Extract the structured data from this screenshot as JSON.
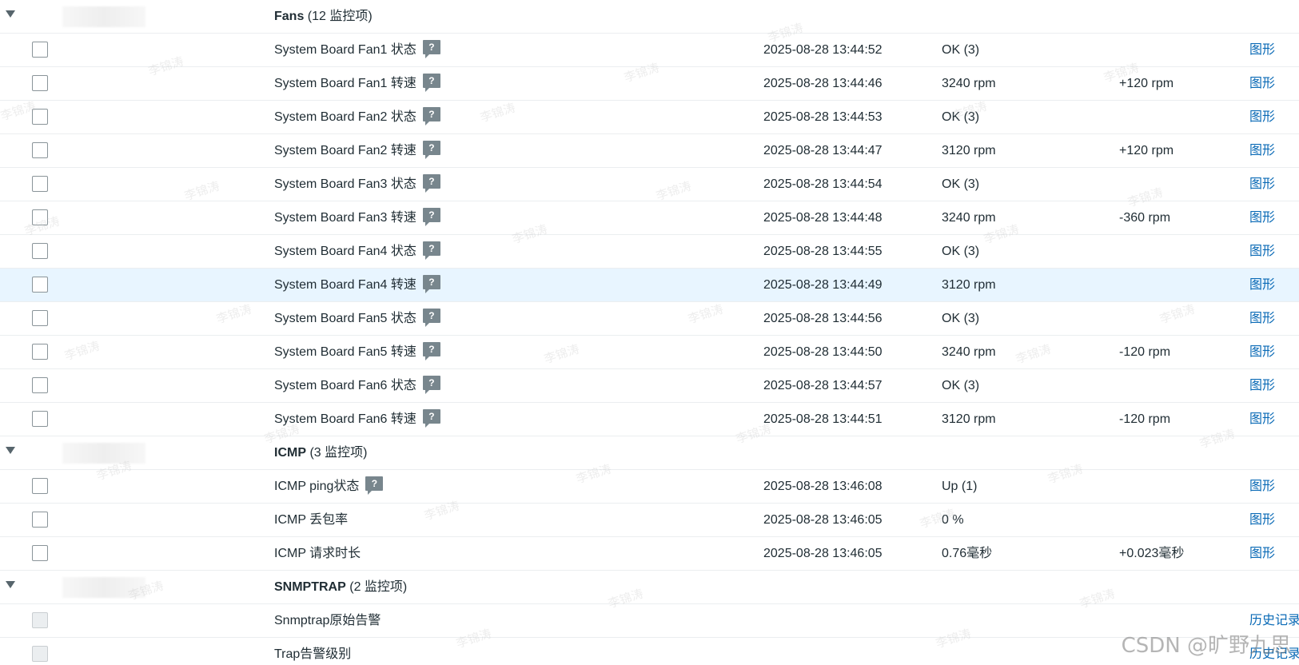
{
  "colors": {
    "link": "#0a6ab6",
    "highlight_row": "#e8f5ff",
    "help_icon_bg": "#78868d",
    "border": "#ebeef0"
  },
  "groups": [
    {
      "name": "Fans",
      "count": "(12 监控项)",
      "items": [
        {
          "name": "System Board Fan1 状态",
          "help": "?",
          "time": "2025-08-28 13:44:52",
          "value": "OK (3)",
          "change": "",
          "link": "图形"
        },
        {
          "name": "System Board Fan1 转速",
          "help": "?",
          "time": "2025-08-28 13:44:46",
          "value": "3240 rpm",
          "change": "+120 rpm",
          "link": "图形"
        },
        {
          "name": "System Board Fan2 状态",
          "help": "?",
          "time": "2025-08-28 13:44:53",
          "value": "OK (3)",
          "change": "",
          "link": "图形"
        },
        {
          "name": "System Board Fan2 转速",
          "help": "?",
          "time": "2025-08-28 13:44:47",
          "value": "3120 rpm",
          "change": "+120 rpm",
          "link": "图形"
        },
        {
          "name": "System Board Fan3 状态",
          "help": "?",
          "time": "2025-08-28 13:44:54",
          "value": "OK (3)",
          "change": "",
          "link": "图形"
        },
        {
          "name": "System Board Fan3 转速",
          "help": "?",
          "time": "2025-08-28 13:44:48",
          "value": "3240 rpm",
          "change": "-360 rpm",
          "link": "图形"
        },
        {
          "name": "System Board Fan4 状态",
          "help": "?",
          "time": "2025-08-28 13:44:55",
          "value": "OK (3)",
          "change": "",
          "link": "图形"
        },
        {
          "name": "System Board Fan4 转速",
          "help": "?",
          "time": "2025-08-28 13:44:49",
          "value": "3120 rpm",
          "change": "",
          "link": "图形"
        },
        {
          "name": "System Board Fan5 状态",
          "help": "?",
          "time": "2025-08-28 13:44:56",
          "value": "OK (3)",
          "change": "",
          "link": "图形"
        },
        {
          "name": "System Board Fan5 转速",
          "help": "?",
          "time": "2025-08-28 13:44:50",
          "value": "3240 rpm",
          "change": "-120 rpm",
          "link": "图形"
        },
        {
          "name": "System Board Fan6 状态",
          "help": "?",
          "time": "2025-08-28 13:44:57",
          "value": "OK (3)",
          "change": "",
          "link": "图形"
        },
        {
          "name": "System Board Fan6 转速",
          "help": "?",
          "time": "2025-08-28 13:44:51",
          "value": "3120 rpm",
          "change": "-120 rpm",
          "link": "图形"
        }
      ]
    },
    {
      "name": "ICMP",
      "count": "(3 监控项)",
      "items": [
        {
          "name": "ICMP ping状态",
          "help": "?",
          "time": "2025-08-28 13:46:08",
          "value": "Up (1)",
          "change": "",
          "link": "图形"
        },
        {
          "name": "ICMP 丢包率",
          "help": "",
          "time": "2025-08-28 13:46:05",
          "value": "0 %",
          "change": "",
          "link": "图形"
        },
        {
          "name": "ICMP 请求时长",
          "help": "",
          "time": "2025-08-28 13:46:05",
          "value": "0.76毫秒",
          "change": "+0.023毫秒",
          "link": "图形"
        }
      ]
    },
    {
      "name": "SNMPTRAP",
      "count": "(2 监控项)",
      "items": [
        {
          "name": "Snmptrap原始告警",
          "help": "",
          "time": "",
          "value": "",
          "change": "",
          "link": "历史记录",
          "disabled": true
        },
        {
          "name": "Trap告警级别",
          "help": "",
          "time": "",
          "value": "",
          "change": "",
          "link": "历史记录",
          "disabled": true
        }
      ]
    }
  ],
  "highlighted_row": "System Board Fan4 转速",
  "watermark_text": "李锦涛",
  "credit": "CSDN @旷野九思"
}
